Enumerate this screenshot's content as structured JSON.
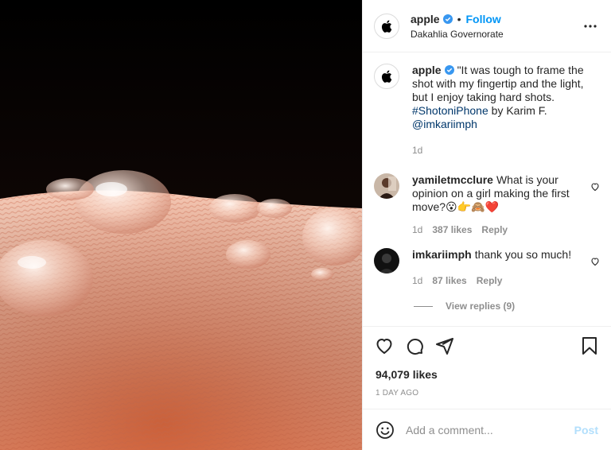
{
  "post": {
    "photo_alt": "",
    "author": {
      "username": "apple",
      "verified": true,
      "follow_label": "Follow",
      "dot": "•",
      "location": "Dakahlia Governorate"
    },
    "caption": {
      "username": "apple",
      "text": "\"It was tough to frame the shot with my fingertip and the light, but I enjoy taking hard shots.",
      "hashtag": "#ShotoniPhone",
      "by_text": " by Karim F.",
      "mention": "@imkariimph",
      "time": "1d"
    },
    "comments": [
      {
        "username": "yamiletmcclure",
        "text": "What is your opinion on a girl making the first move?😮👉🙈❤️",
        "time": "1d",
        "likes": "387 likes",
        "reply_label": "Reply"
      },
      {
        "username": "imkariimph",
        "text": "thank you so much!",
        "time": "1d",
        "likes": "87 likes",
        "reply_label": "Reply"
      }
    ],
    "view_replies": "View replies (9)",
    "likes_count": "94,079 likes",
    "posted_ago": "1 DAY AGO",
    "add_comment": {
      "placeholder": "Add a comment...",
      "post_label": "Post"
    }
  },
  "colors": {
    "accent": "#0095f6",
    "verified": "#3897f0",
    "post_disabled": "#b2dffc",
    "heart_red": "#ed4956"
  },
  "icons": [
    "apple-logo-icon",
    "verified-badge-icon",
    "more-options-icon",
    "heart-icon",
    "comment-icon",
    "share-icon",
    "bookmark-icon",
    "emoji-icon"
  ]
}
